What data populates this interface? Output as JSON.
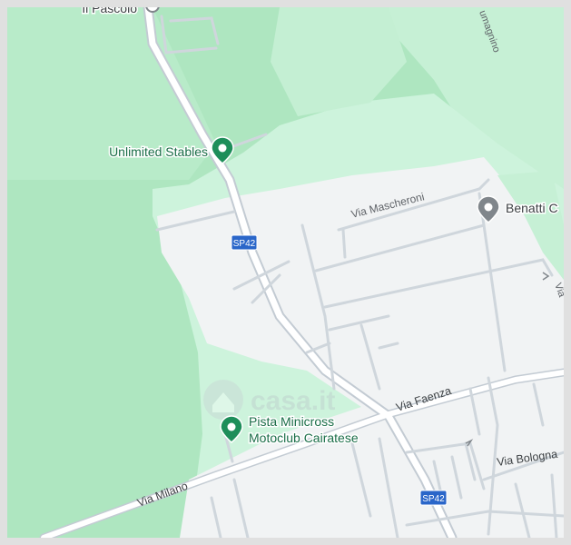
{
  "map": {
    "pois": [
      {
        "id": "il-pascolo",
        "name": "Il Pascolo"
      },
      {
        "id": "unlimited-stables",
        "name": "Unlimited Stables"
      },
      {
        "id": "benatti",
        "name": "Benatti C"
      },
      {
        "id": "pista-minicross",
        "name_line1": "Pista Minicross",
        "name_line2": "Motoclub Cairatese"
      }
    ],
    "streets": {
      "via_maschereni": "Via Mascheroni",
      "via_faenza": "Via Faenza",
      "via_bologna": "Via Bologna",
      "via_milano": "Via Milano",
      "magnino": "umagnino",
      "edge_via": "Via"
    },
    "route_shields": [
      "SP42",
      "SP42"
    ],
    "watermark": "casa.it",
    "colors": {
      "park_green": "#aee6c0",
      "light_green": "#cdf3dc",
      "urban": "#f1f3f4",
      "road": "#ffffff",
      "road_outline": "#c3cbd3",
      "poi_green": "#1e8e5a",
      "poi_gray": "#80868b",
      "label_text": "#3c4043",
      "shield_blue": "#2a66c9"
    },
    "icons": [
      "green-pin-icon",
      "gray-pin-icon"
    ]
  }
}
